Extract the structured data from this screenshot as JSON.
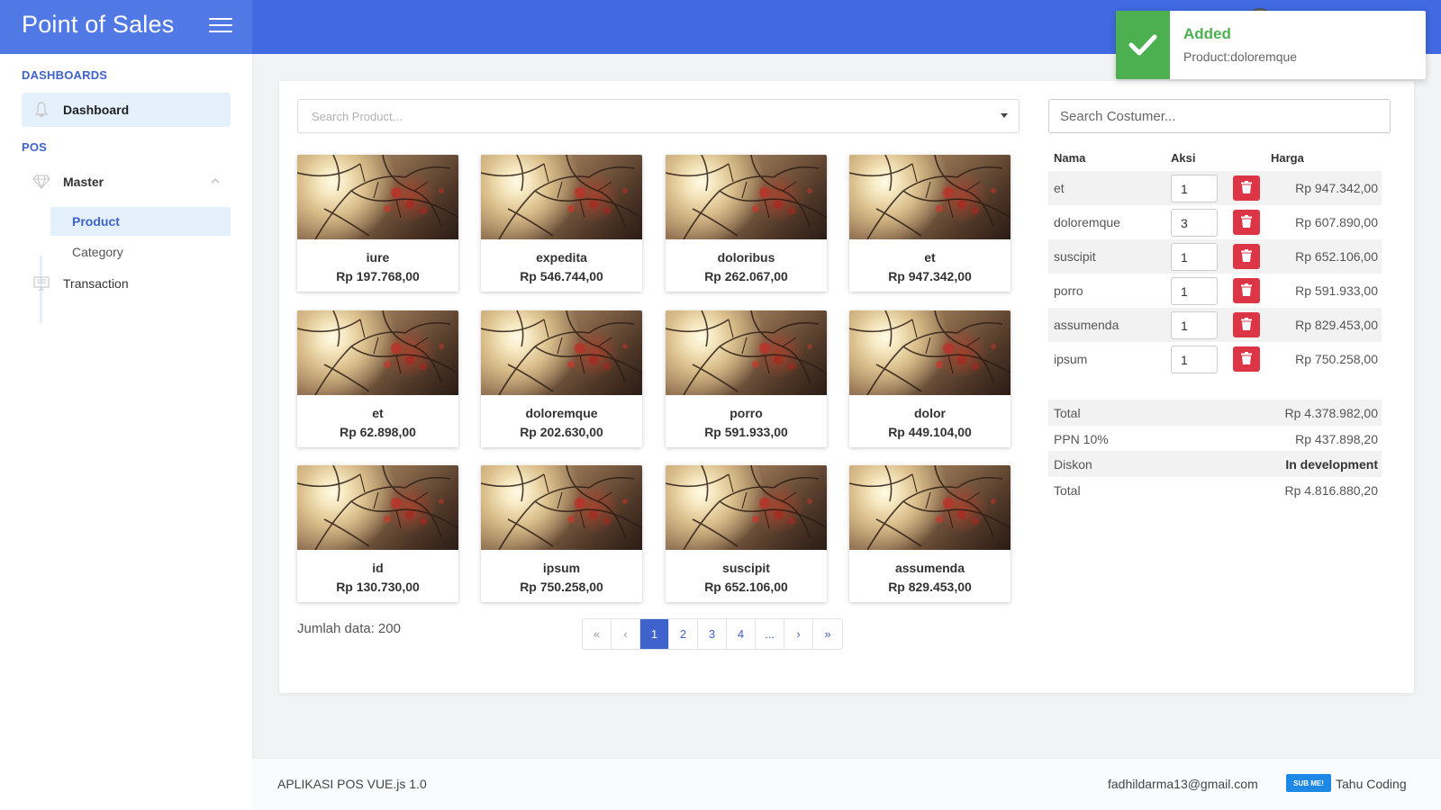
{
  "header": {
    "app_title": "Point of Sales"
  },
  "sidebar": {
    "section_dashboards": "DASHBOARDS",
    "dashboard_label": "Dashboard",
    "section_pos": "POS",
    "master_label": "Master",
    "product_label": "Product",
    "category_label": "Category",
    "transaction_label": "Transaction"
  },
  "search": {
    "product_placeholder": "Search Product...",
    "customer_placeholder": "Search Costumer..."
  },
  "products": [
    {
      "name": "iure",
      "price": "Rp 197.768,00"
    },
    {
      "name": "expedita",
      "price": "Rp 546.744,00"
    },
    {
      "name": "doloribus",
      "price": "Rp 262.067,00"
    },
    {
      "name": "et",
      "price": "Rp 947.342,00"
    },
    {
      "name": "et",
      "price": "Rp 62.898,00"
    },
    {
      "name": "doloremque",
      "price": "Rp 202.630,00"
    },
    {
      "name": "porro",
      "price": "Rp 591.933,00"
    },
    {
      "name": "dolor",
      "price": "Rp 449.104,00"
    },
    {
      "name": "id",
      "price": "Rp 130.730,00"
    },
    {
      "name": "ipsum",
      "price": "Rp 750.258,00"
    },
    {
      "name": "suscipit",
      "price": "Rp 652.106,00"
    },
    {
      "name": "assumenda",
      "price": "Rp 829.453,00"
    }
  ],
  "jumlah": {
    "label": "Jumlah data:",
    "value": "200"
  },
  "pagination": {
    "first": "«",
    "prev": "‹",
    "pages": [
      "1",
      "2",
      "3",
      "4"
    ],
    "ellipsis": "...",
    "next": "›",
    "last": "»",
    "active": "1"
  },
  "cart": {
    "headers": {
      "name": "Nama",
      "action": "Aksi",
      "price": "Harga"
    },
    "items": [
      {
        "name": "et",
        "qty": "1",
        "price": "Rp 947.342,00"
      },
      {
        "name": "doloremque",
        "qty": "3",
        "price": "Rp 607.890,00"
      },
      {
        "name": "suscipit",
        "qty": "1",
        "price": "Rp 652.106,00"
      },
      {
        "name": "porro",
        "qty": "1",
        "price": "Rp 591.933,00"
      },
      {
        "name": "assumenda",
        "qty": "1",
        "price": "Rp 829.453,00"
      },
      {
        "name": "ipsum",
        "qty": "1",
        "price": "Rp 750.258,00"
      }
    ]
  },
  "summary": [
    {
      "label": "Total",
      "value": "Rp 4.378.982,00"
    },
    {
      "label": "PPN 10%",
      "value": "Rp 437.898,20"
    },
    {
      "label": "Diskon",
      "value": "In development"
    },
    {
      "label": "Total",
      "value": "Rp 4.816.880,20"
    }
  ],
  "toast": {
    "title": "Added",
    "message": "Product:doloremque"
  },
  "footer": {
    "app_version": "APLIKASI POS VUE.js 1.0",
    "email": "fadhildarma13@gmail.com",
    "badge": "SUB ME!",
    "brand": "Tahu Coding"
  },
  "colors": {
    "primary": "#4169e1",
    "danger": "#dc3545",
    "success": "#4caf50",
    "active_bg": "#e4f1fd"
  }
}
